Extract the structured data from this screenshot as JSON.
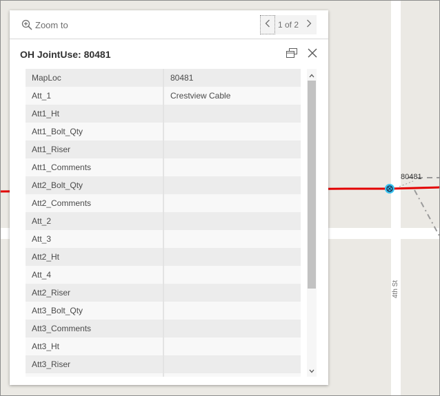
{
  "map": {
    "pole_label": "80481",
    "street_label": "4th St",
    "colors": {
      "background": "#ebe9e4",
      "road": "#ffffff",
      "line": "#e30000",
      "pole": "#39c3f0"
    }
  },
  "popup": {
    "zoom_label": "Zoom to",
    "pager": "1 of 2",
    "title": "OH JointUse: 80481",
    "attributes": [
      {
        "key": "MapLoc",
        "value": "80481"
      },
      {
        "key": "Att_1",
        "value": "Crestview Cable"
      },
      {
        "key": "Att1_Ht",
        "value": ""
      },
      {
        "key": "Att1_Bolt_Qty",
        "value": ""
      },
      {
        "key": "Att1_Riser",
        "value": ""
      },
      {
        "key": "Att1_Comments",
        "value": ""
      },
      {
        "key": "Att2_Bolt_Qty",
        "value": ""
      },
      {
        "key": "Att2_Comments",
        "value": ""
      },
      {
        "key": "Att_2",
        "value": ""
      },
      {
        "key": "Att_3",
        "value": ""
      },
      {
        "key": "Att2_Ht",
        "value": ""
      },
      {
        "key": "Att_4",
        "value": ""
      },
      {
        "key": "Att2_Riser",
        "value": ""
      },
      {
        "key": "Att3_Bolt_Qty",
        "value": ""
      },
      {
        "key": "Att3_Comments",
        "value": ""
      },
      {
        "key": "Att3_Ht",
        "value": ""
      },
      {
        "key": "Att3_Riser",
        "value": ""
      },
      {
        "key": "",
        "value": ""
      }
    ]
  },
  "icons": {
    "zoom": "zoom-in-icon",
    "prev": "chevron-left-icon",
    "next": "chevron-right-icon",
    "dock": "dock-icon",
    "close": "close-icon",
    "scroll_up": "scroll-up-icon",
    "scroll_down": "scroll-down-icon"
  }
}
